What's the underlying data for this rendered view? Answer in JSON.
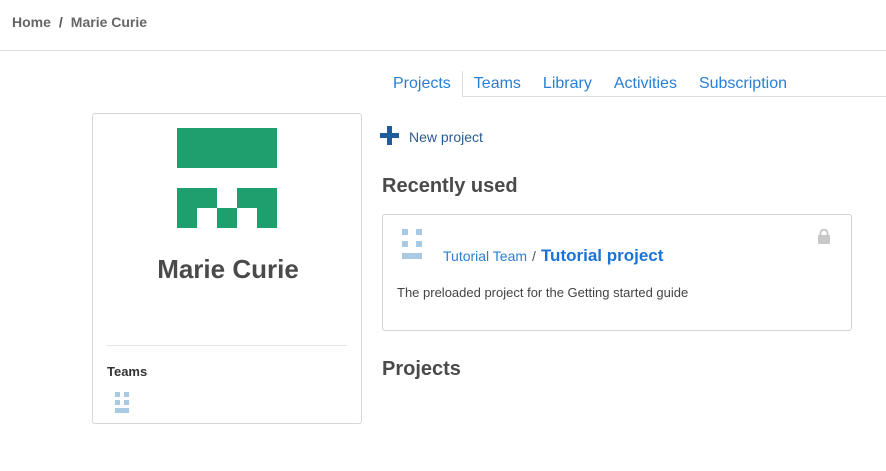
{
  "breadcrumb": {
    "home": "Home",
    "separator": "/",
    "current": "Marie Curie"
  },
  "tabs": [
    {
      "label": "Projects",
      "active": true
    },
    {
      "label": "Teams",
      "active": false
    },
    {
      "label": "Library",
      "active": false
    },
    {
      "label": "Activities",
      "active": false
    },
    {
      "label": "Subscription",
      "active": false
    }
  ],
  "profile": {
    "name": "Marie Curie",
    "teams_title": "Teams",
    "avatar_color": "#1f9e6e"
  },
  "main": {
    "new_project_label": "New project",
    "recently_used_title": "Recently used",
    "projects_title": "Projects"
  },
  "recent_project": {
    "team": "Tutorial Team",
    "separator": "/",
    "name": "Tutorial project",
    "description": "The preloaded project for the Getting started guide"
  },
  "colors": {
    "link": "#2a7fd4",
    "icon_light_blue": "#a8cbe3"
  }
}
